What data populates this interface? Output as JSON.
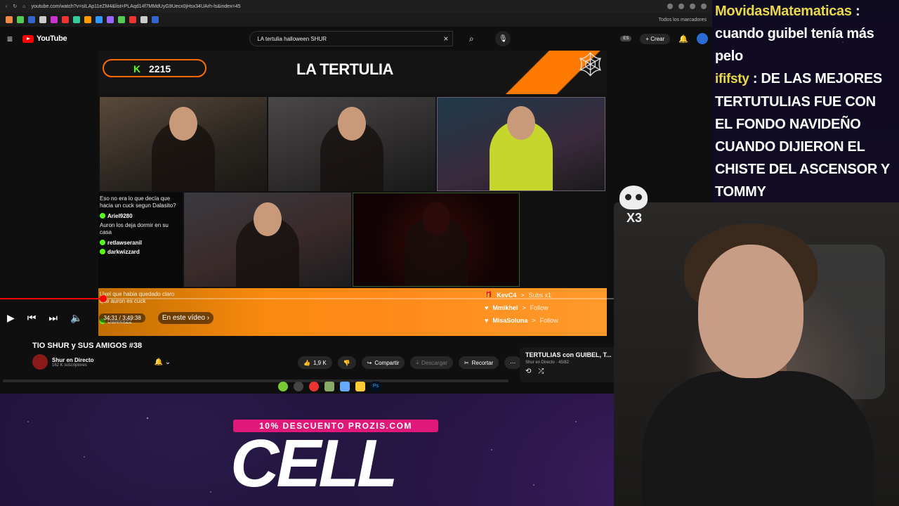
{
  "browser": {
    "url": "youtube.com/watch?v=sILAp11eZM4&list=PLAqd14f7MMdUyG9Uecx0jHsx34UArh-ls&index=45",
    "bookmarks_folder": "Todos los marcadores"
  },
  "youtube": {
    "logo_text": "YouTube",
    "search_value": "LA tertulia halloween SHUR",
    "create_label": "Crear",
    "region_badge": "ES"
  },
  "stream_overlay": {
    "kick_count": "2215",
    "title": "LA TERTULIA",
    "chat": [
      {
        "type": "line",
        "text": "Eso no era lo que decía que hacia un cuck segun Dalasito?"
      },
      {
        "type": "user",
        "text": "Ariel9280"
      },
      {
        "type": "line",
        "text": "Auron los deja dormir en su casa"
      },
      {
        "type": "user",
        "text": "retlawseranil"
      },
      {
        "type": "user",
        "text": "darkwizzard"
      },
      {
        "type": "line",
        "text": "Uxel que habia quedado claro que auron es cuck"
      },
      {
        "type": "user",
        "text": "Dalexx22"
      }
    ],
    "events": [
      {
        "name": "KevC4",
        "action": "Subs x1",
        "icon": "gift-icon"
      },
      {
        "name": "Mmikhel",
        "action": "Follow",
        "icon": "heart-icon"
      },
      {
        "name": "MisaSoluna",
        "action": "Follow",
        "icon": "heart-icon"
      }
    ]
  },
  "player": {
    "time": "34:31 / 3:49:38",
    "chapter": "En este vídeo",
    "progress_fraction": 0.145
  },
  "video": {
    "title": "TIO SHUR y SUS AMIGOS #38",
    "channel": "Shur en Directo",
    "subscribers": "162 K suscriptores",
    "likes": "1,9 K",
    "share": "Compartir",
    "download": "Descargar",
    "clip": "Recortar"
  },
  "playlist": {
    "title": "TERTULIAS con GUIBEL, T...",
    "subtitle": "Shur en Directo · 45/82"
  },
  "side_chat": [
    {
      "user": "MovidasMatematicas",
      "sep": " :",
      "message": "cuando guibel tenía más pelo"
    },
    {
      "user": "ififsty",
      "sep": " :",
      "message": "DE LAS MEJORES TERTUTULIAS FUE CON EL FONDO NAVIDEÑO CUANDO DIJIERON EL CHISTE DEL ASCENSOR Y TOMMY"
    }
  ],
  "overlay_badge": "X3",
  "promo": {
    "badge": "10% DESCUENTO PROZIS.COM",
    "code": "CELL"
  }
}
